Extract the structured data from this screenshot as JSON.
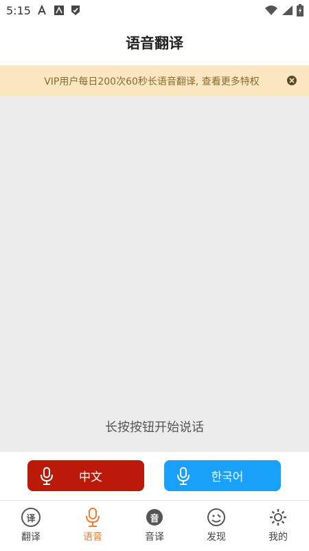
{
  "status": {
    "time": "5:15"
  },
  "header": {
    "title": "语音翻译"
  },
  "banner": {
    "text": "VIP用户每日200次60秒长语音翻译, 查看更多特权"
  },
  "main": {
    "hint": "长按按钮开始说话"
  },
  "buttons": {
    "left": {
      "label": "中文",
      "color": "#bb1a0b"
    },
    "right": {
      "label": "한국어",
      "color": "#18a0fb"
    }
  },
  "tabs": [
    {
      "label": "翻译",
      "icon": "translate-icon",
      "glyph": "译"
    },
    {
      "label": "语音",
      "icon": "microphone-icon"
    },
    {
      "label": "音译",
      "icon": "transliterate-icon",
      "glyph": "音"
    },
    {
      "label": "发现",
      "icon": "discover-icon"
    },
    {
      "label": "我的",
      "icon": "settings-icon"
    }
  ],
  "accent": "#f07b2c"
}
